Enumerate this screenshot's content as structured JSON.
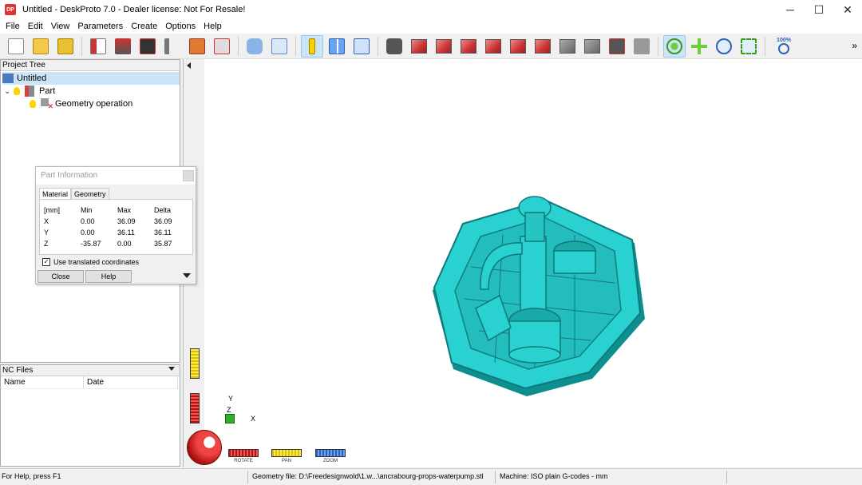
{
  "window": {
    "title": "Untitled - DeskProto 7.0 - Dealer license: Not For Resale!",
    "app_icon_text": "DP",
    "controls": [
      "─",
      "☐",
      "✕"
    ]
  },
  "menu": [
    "File",
    "Edit",
    "View",
    "Parameters",
    "Create",
    "Options",
    "Help"
  ],
  "toolbar": {
    "zoom_label": "100%",
    "more_glyph": "»"
  },
  "project_tree": {
    "header": "Project Tree",
    "root": "Untitled",
    "part": "Part",
    "operation": "Geometry operation"
  },
  "nc_files": {
    "header": "NC Files",
    "columns": [
      "Name",
      "Date"
    ]
  },
  "part_info": {
    "title": "Part Information",
    "tabs": [
      "Material",
      "Geometry"
    ],
    "headers": [
      "[mm]",
      "Min",
      "Max",
      "Delta"
    ],
    "rows": [
      [
        "X",
        "0.00",
        "36.09",
        "36.09"
      ],
      [
        "Y",
        "0.00",
        "36.11",
        "36.11"
      ],
      [
        "Z",
        "-35.87",
        "0.00",
        "35.87"
      ]
    ],
    "checkbox_label": "Use translated coordinates",
    "checkbox_checked": true,
    "close_label": "Close",
    "help_label": "Help"
  },
  "viewport": {
    "model_color": "#2ad1d1",
    "axis_y": "Y",
    "axis_z": "Z",
    "axis_x": "X",
    "controls": [
      "ROTATE",
      "PAN",
      "ZOOM"
    ]
  },
  "status": {
    "help": "For Help, press F1",
    "geometry": "Geometry file: D:\\Freedesignwold\\1.w...\\ancrabourg-props-waterpump.stl",
    "machine": "Machine: ISO plain G-codes - mm"
  }
}
